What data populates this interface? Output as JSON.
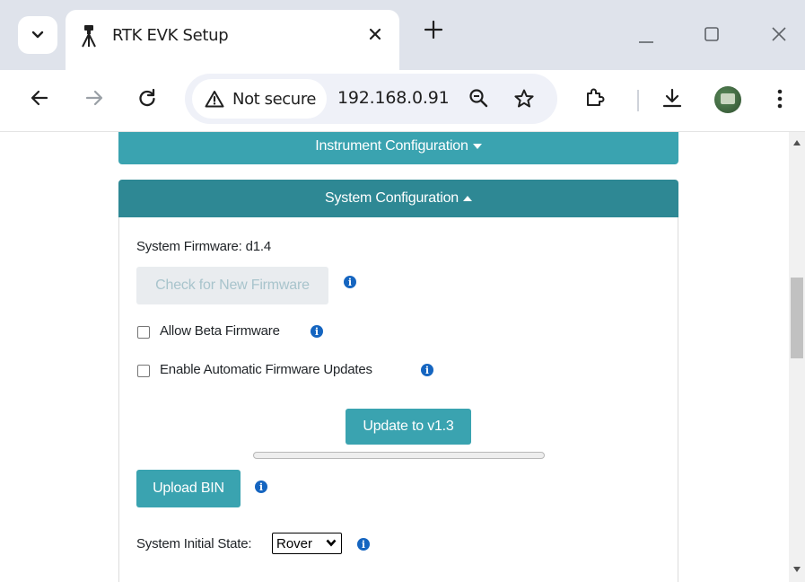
{
  "browser": {
    "tab": {
      "title": "RTK EVK Setup"
    },
    "address": {
      "security_label": "Not secure",
      "url": "192.168.0.91"
    }
  },
  "page": {
    "instrument_config": {
      "label": "Instrument Configuration"
    },
    "system_config": {
      "label": "System Configuration",
      "firmware_label": "System Firmware: d1.4",
      "check_button": "Check for New Firmware",
      "beta_checkbox_label": "Allow Beta Firmware",
      "beta_checked": false,
      "auto_update_label": "Enable Automatic Firmware Updates",
      "auto_update_checked": false,
      "update_button": "Update to v1.3",
      "update_progress": 0,
      "upload_button": "Upload BIN",
      "initial_state_label": "System Initial State:",
      "initial_state_value": "Rover"
    }
  },
  "colors": {
    "accent": "#3aa3b0",
    "header_dark": "#2e8894",
    "info_icon": "#1565c0"
  }
}
